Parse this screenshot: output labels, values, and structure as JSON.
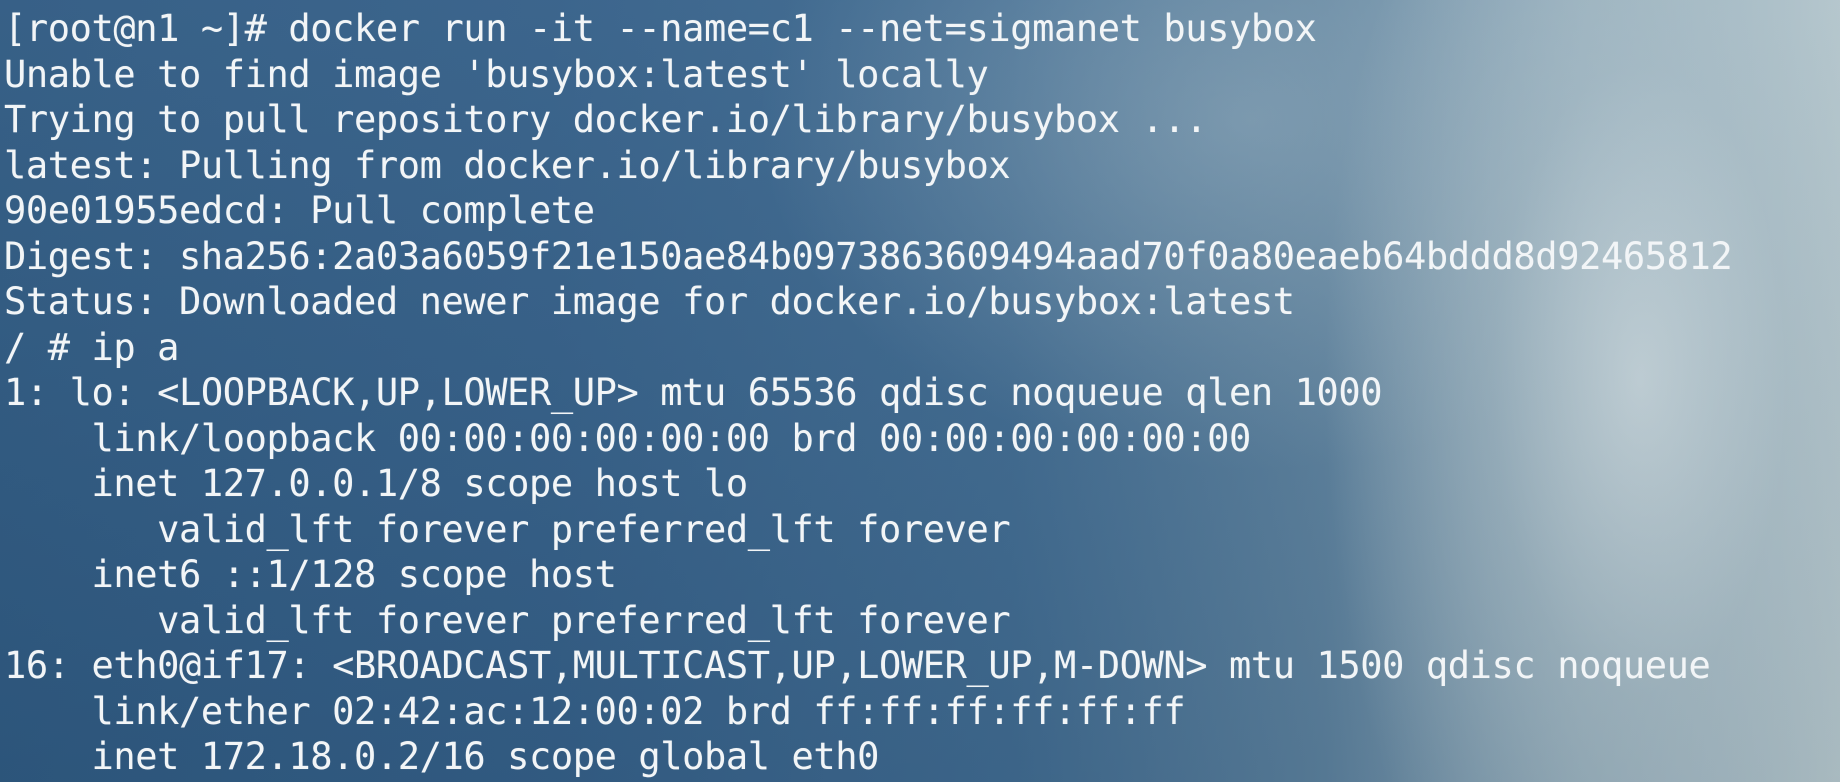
{
  "terminal": {
    "lines": [
      "[root@n1 ~]# docker run -it --name=c1 --net=sigmanet busybox",
      "Unable to find image 'busybox:latest' locally",
      "Trying to pull repository docker.io/library/busybox ...",
      "latest: Pulling from docker.io/library/busybox",
      "90e01955edcd: Pull complete",
      "Digest: sha256:2a03a6059f21e150ae84b0973863609494aad70f0a80eaeb64bddd8d92465812",
      "Status: Downloaded newer image for docker.io/busybox:latest",
      "/ # ip a",
      "1: lo: <LOOPBACK,UP,LOWER_UP> mtu 65536 qdisc noqueue qlen 1000",
      "    link/loopback 00:00:00:00:00:00 brd 00:00:00:00:00:00",
      "    inet 127.0.0.1/8 scope host lo",
      "       valid_lft forever preferred_lft forever",
      "    inet6 ::1/128 scope host",
      "       valid_lft forever preferred_lft forever",
      "16: eth0@if17: <BROADCAST,MULTICAST,UP,LOWER_UP,M-DOWN> mtu 1500 qdisc noqueue",
      "    link/ether 02:42:ac:12:00:02 brd ff:ff:ff:ff:ff:ff",
      "    inet 172.18.0.2/16 scope global eth0"
    ]
  }
}
